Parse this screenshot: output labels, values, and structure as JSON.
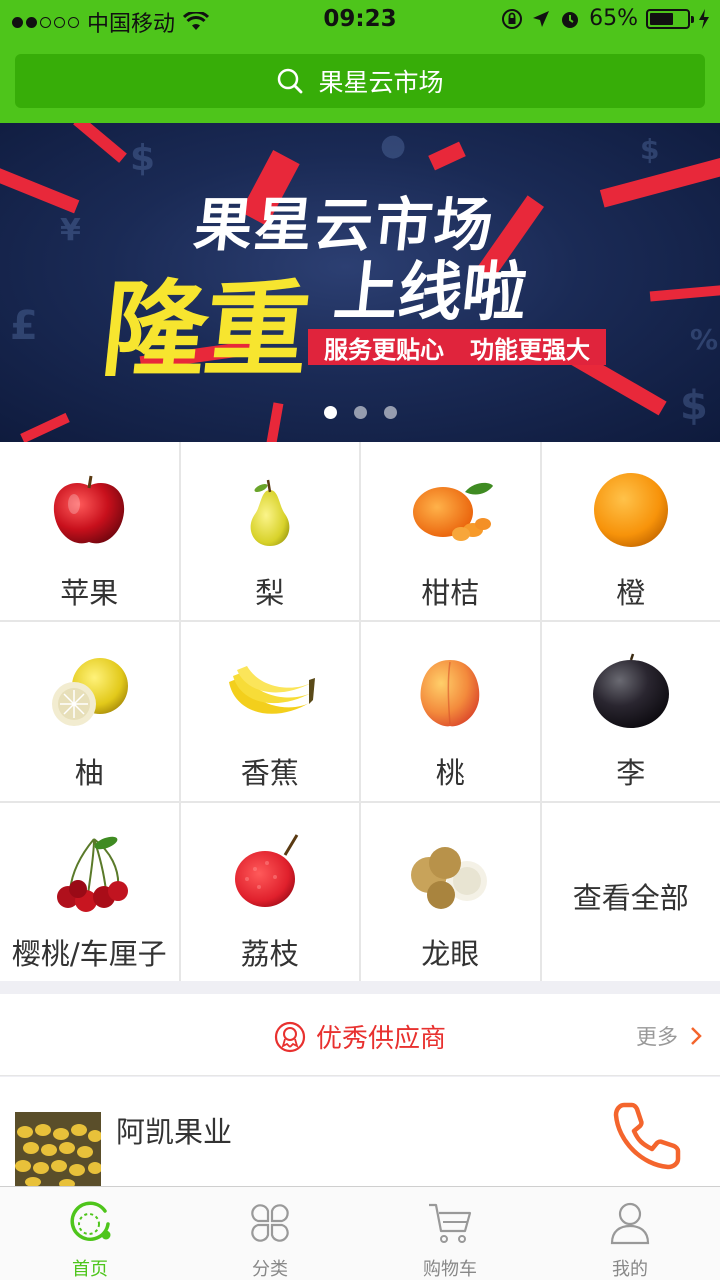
{
  "status_bar": {
    "carrier": "中国移动",
    "time": "09:23",
    "battery": "65%",
    "battery_level": 0.65,
    "signal_dots_filled": 2,
    "signal_dots_total": 5
  },
  "search": {
    "placeholder": "果星云市场",
    "icon": "search-icon"
  },
  "banner": {
    "title": "果星云市场",
    "big_text": "隆重",
    "sub_text": "上线啦",
    "slogan_1": "服务更贴心",
    "slogan_2": "功能更强大",
    "page_count": 3,
    "active_page": 1
  },
  "categories": [
    {
      "label": "苹果",
      "icon": "apple-icon"
    },
    {
      "label": "梨",
      "icon": "pear-icon"
    },
    {
      "label": "柑桔",
      "icon": "mandarin-icon"
    },
    {
      "label": "橙",
      "icon": "orange-icon"
    },
    {
      "label": "柚",
      "icon": "pomelo-icon"
    },
    {
      "label": "香蕉",
      "icon": "banana-icon"
    },
    {
      "label": "桃",
      "icon": "peach-icon"
    },
    {
      "label": "李",
      "icon": "plum-icon"
    },
    {
      "label": "樱桃/车厘子",
      "icon": "cherry-icon"
    },
    {
      "label": "荔枝",
      "icon": "lychee-icon"
    },
    {
      "label": "龙眼",
      "icon": "longan-icon"
    },
    {
      "label": "查看全部"
    }
  ],
  "suppliers": {
    "title": "优秀供应商",
    "more": "更多",
    "items": [
      {
        "name": "阿凯果业"
      }
    ]
  },
  "tabs": [
    {
      "label": "首页",
      "icon": "home-icon",
      "active": true
    },
    {
      "label": "分类",
      "icon": "category-icon",
      "active": false
    },
    {
      "label": "购物车",
      "icon": "cart-icon",
      "active": false
    },
    {
      "label": "我的",
      "icon": "user-icon",
      "active": false
    }
  ],
  "colors": {
    "brand": "#4ec51b",
    "brand_dark": "#37ad08",
    "accent_red": "#e8312f",
    "phone_orange": "#f4652d"
  }
}
